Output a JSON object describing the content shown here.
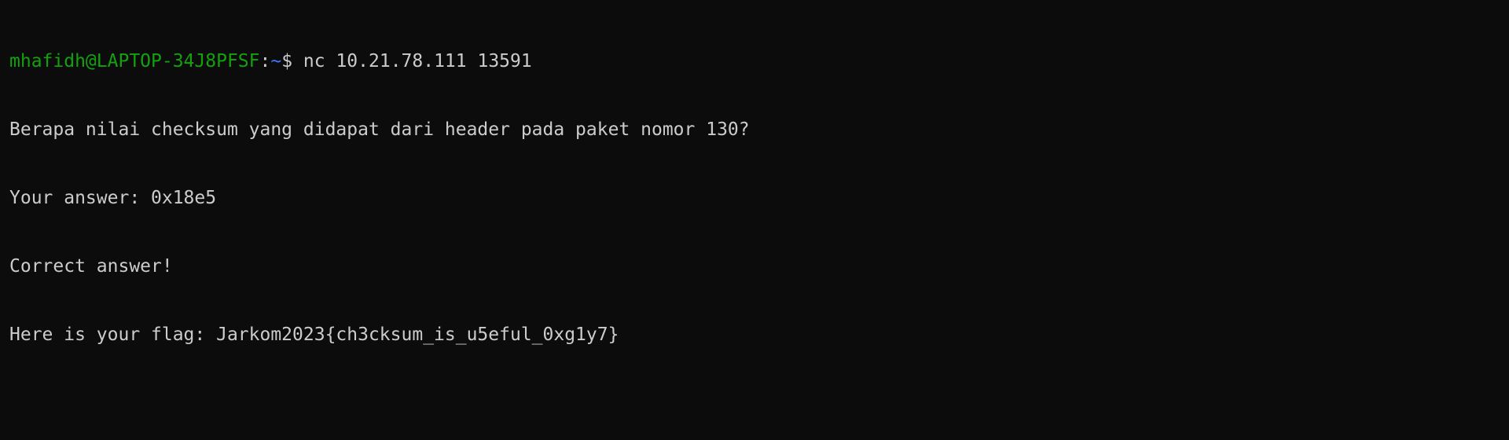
{
  "terminal": {
    "prompt": {
      "user_host": "mhafidh@LAPTOP-34J8PFSF",
      "colon": ":",
      "path": "~",
      "symbol": "$ "
    },
    "command": "nc 10.21.78.111 13591",
    "output": [
      "Berapa nilai checksum yang didapat dari header pada paket nomor 130?",
      "Your answer: 0x18e5",
      "Correct answer!",
      "Here is your flag: Jarkom2023{ch3cksum_is_u5eful_0xg1y7}"
    ]
  },
  "colors": {
    "background": "#0c0c0c",
    "foreground": "#cccccc",
    "prompt_user": "#13a10e",
    "prompt_path": "#3b78ff"
  }
}
